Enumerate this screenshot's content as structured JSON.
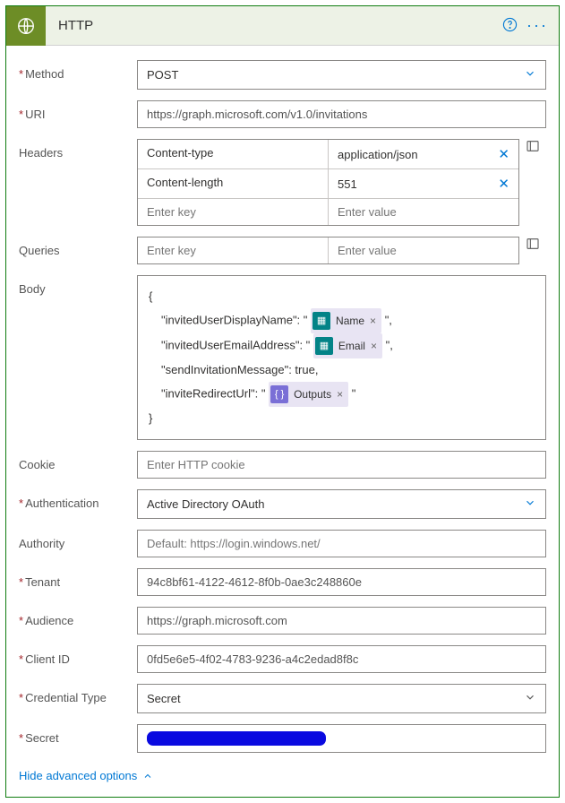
{
  "header": {
    "title": "HTTP"
  },
  "fields": {
    "method": {
      "label": "Method",
      "value": "POST"
    },
    "uri": {
      "label": "URI",
      "value": "https://graph.microsoft.com/v1.0/invitations"
    },
    "headers": {
      "label": "Headers",
      "rows": [
        {
          "key": "Content-type",
          "value": "application/json"
        },
        {
          "key": "Content-length",
          "value": "551"
        }
      ],
      "placeholder_key": "Enter key",
      "placeholder_value": "Enter value"
    },
    "queries": {
      "label": "Queries",
      "placeholder_key": "Enter key",
      "placeholder_value": "Enter value"
    },
    "body": {
      "label": "Body",
      "open": "{",
      "line1_pre": "\"invitedUserDisplayName\": \"",
      "token1": "Name",
      "line1_post": "\",",
      "line2_pre": "\"invitedUserEmailAddress\": \"",
      "token2": "Email",
      "line2_post": "\",",
      "line3": "\"sendInvitationMessage\": true,",
      "line4_pre": "\"inviteRedirectUrl\": \"",
      "token3": "Outputs",
      "line4_post": "\"",
      "close": "}"
    },
    "cookie": {
      "label": "Cookie",
      "placeholder": "Enter HTTP cookie"
    },
    "authentication": {
      "label": "Authentication",
      "value": "Active Directory OAuth"
    },
    "authority": {
      "label": "Authority",
      "placeholder": "Default: https://login.windows.net/"
    },
    "tenant": {
      "label": "Tenant",
      "value": "94c8bf61-4122-4612-8f0b-0ae3c248860e"
    },
    "audience": {
      "label": "Audience",
      "value": "https://graph.microsoft.com"
    },
    "client_id": {
      "label": "Client ID",
      "value": "0fd5e6e5-4f02-4783-9236-a4c2edad8f8c"
    },
    "credential_type": {
      "label": "Credential Type",
      "value": "Secret"
    },
    "secret": {
      "label": "Secret"
    }
  },
  "footer": {
    "advanced": "Hide advanced options"
  }
}
